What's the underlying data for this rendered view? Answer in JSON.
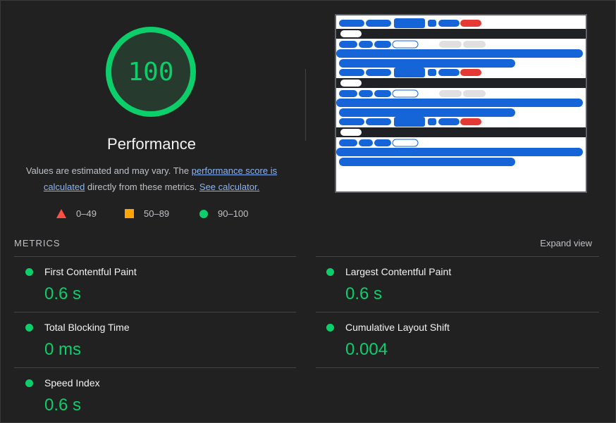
{
  "score": "100",
  "title": "Performance",
  "description": {
    "prefix": "Values are estimated and may vary. The ",
    "link1": "performance score is calculated",
    "middle": " directly from these metrics. ",
    "link2": "See calculator."
  },
  "legend": [
    {
      "range": "0–49",
      "shape": "triangle",
      "color": "#ff4e42"
    },
    {
      "range": "50–89",
      "shape": "square",
      "color": "#ffa400"
    },
    {
      "range": "90–100",
      "shape": "circle",
      "color": "#0cce6b"
    }
  ],
  "metrics_header": "METRICS",
  "expand_label": "Expand view",
  "metrics": [
    {
      "name": "First Contentful Paint",
      "value": "0.6 s"
    },
    {
      "name": "Largest Contentful Paint",
      "value": "0.6 s"
    },
    {
      "name": "Total Blocking Time",
      "value": "0 ms"
    },
    {
      "name": "Cumulative Layout Shift",
      "value": "0.004"
    },
    {
      "name": "Speed Index",
      "value": "0.6 s"
    }
  ],
  "colors": {
    "pass": "#0cce6b",
    "background": "#212121",
    "link": "#8ab4f8"
  }
}
